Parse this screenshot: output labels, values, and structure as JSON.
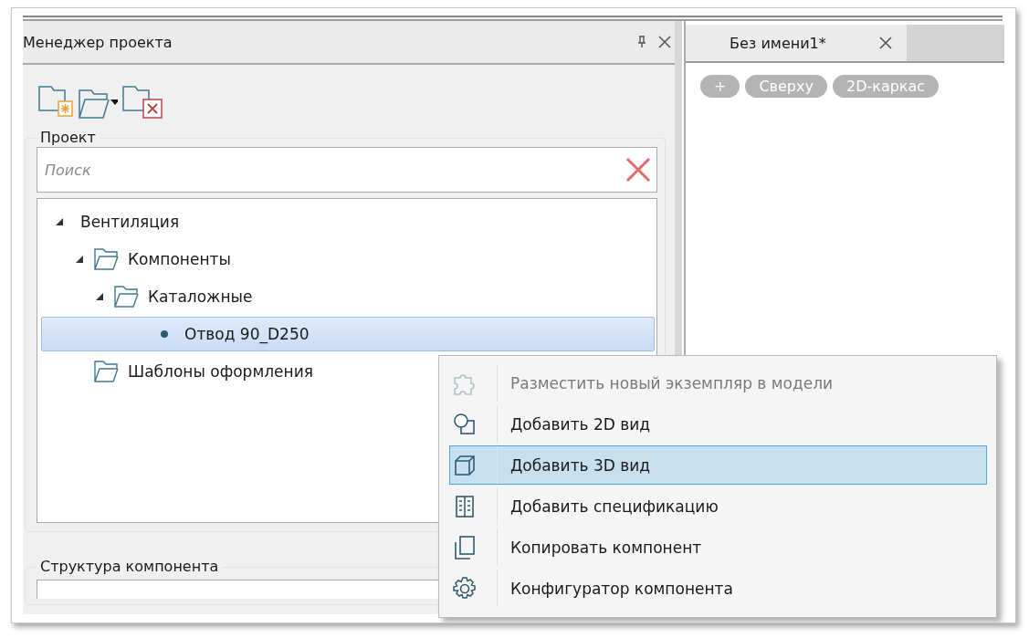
{
  "project_panel": {
    "title": "Менеджер проекта",
    "group_label": "Проект",
    "search": {
      "placeholder": "Поиск"
    },
    "tree": [
      {
        "label": "Вентиляция",
        "kind": "root",
        "expanded": true,
        "selected": false,
        "children": [
          {
            "label": "Компоненты",
            "kind": "folder",
            "expanded": true,
            "selected": false,
            "children": [
              {
                "label": "Каталожные",
                "kind": "folder",
                "expanded": true,
                "selected": false,
                "children": [
                  {
                    "label": "Отвод 90_D250",
                    "kind": "item",
                    "selected": true
                  }
                ]
              }
            ]
          },
          {
            "label": "Шаблоны оформления",
            "kind": "folder",
            "selected": false
          }
        ]
      }
    ],
    "structure_label": "Структура компонента"
  },
  "document": {
    "tab": "Без имени1*",
    "view_chips": [
      "+",
      "Сверху",
      "2D-каркас"
    ]
  },
  "context_menu": [
    {
      "label": "Разместить новый экземпляр в модели",
      "kind": "puzzle",
      "disabled": true,
      "selected": false
    },
    {
      "label": "Добавить 2D вид",
      "kind": "view2d",
      "disabled": false,
      "selected": false
    },
    {
      "label": "Добавить 3D вид",
      "kind": "view3d",
      "disabled": false,
      "selected": true
    },
    {
      "label": "Добавить спецификацию",
      "kind": "spec",
      "disabled": false,
      "selected": false
    },
    {
      "label": "Копировать компонент",
      "kind": "copy",
      "disabled": false,
      "selected": false
    },
    {
      "label": "Конфигуратор компонента",
      "kind": "gear",
      "disabled": false,
      "selected": false
    }
  ]
}
